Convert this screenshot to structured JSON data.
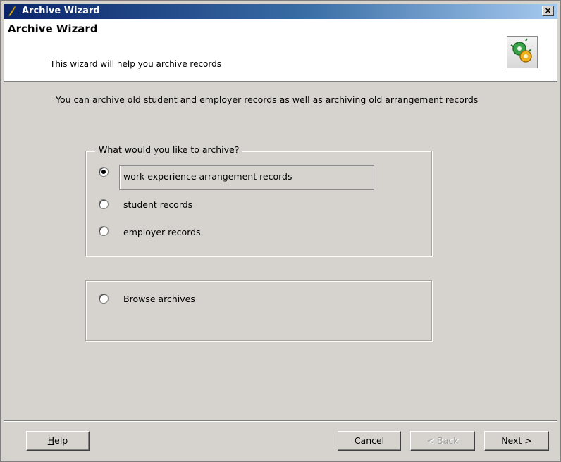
{
  "window": {
    "title": "Archive Wizard",
    "close_label": "×"
  },
  "header": {
    "title": "Archive Wizard",
    "subtitle": "This wizard will help you archive records"
  },
  "intro_text": "You can archive old student and employer records as well as archiving old arrangement records",
  "archive_group": {
    "legend": "What would you  like to archive?",
    "options": [
      {
        "label": "work experience arrangement records",
        "selected": true
      },
      {
        "label": "student records",
        "selected": false
      },
      {
        "label": "employer records",
        "selected": false
      }
    ]
  },
  "browse_group": {
    "option": {
      "label": "Browse  archives",
      "selected": false
    }
  },
  "buttons": {
    "help_accel": "H",
    "help_rest": "elp",
    "cancel": "Cancel",
    "back": "< Back",
    "next": "Next >"
  },
  "icons": {
    "title_icon": "quill-icon",
    "wizard_icon": "gears-wizard-icon"
  }
}
